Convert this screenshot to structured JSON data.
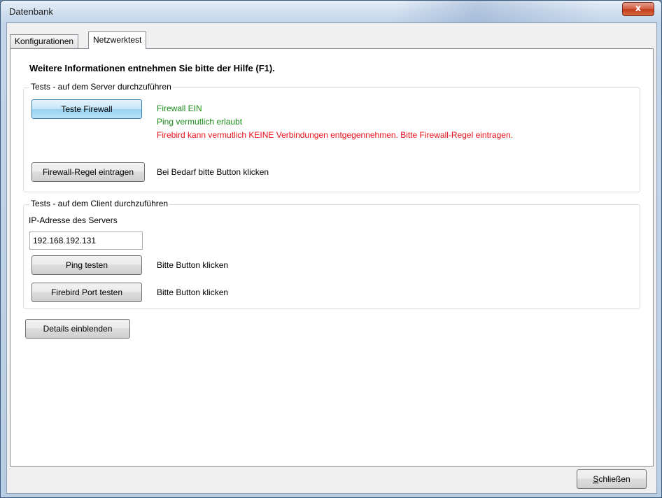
{
  "window": {
    "title": "Datenbank",
    "close_label": "x"
  },
  "tabs": [
    {
      "label": "Konfigurationen",
      "active": false
    },
    {
      "label": "Netzwerktest",
      "active": true
    }
  ],
  "heading": "Weitere Informationen entnehmen Sie bitte der Hilfe (F1).",
  "server_group": {
    "title": "Tests - auf dem Server durchzuführen",
    "test_firewall_button": "Teste Firewall",
    "status_lines": [
      {
        "text": "Firewall EIN",
        "color": "#1a8a1a"
      },
      {
        "text": "Ping vermutlich erlaubt",
        "color": "#1a8a1a"
      },
      {
        "text": "Firebird kann vermutlich KEINE Verbindungen entgegennehmen. Bitte Firewall-Regel eintragen.",
        "color": "#e8101a"
      }
    ],
    "add_rule_button": "Firewall-Regel eintragen",
    "add_rule_hint": "Bei Bedarf bitte Button klicken"
  },
  "client_group": {
    "title": "Tests - auf dem Client durchzuführen",
    "ip_label": "IP-Adresse des Servers",
    "ip_value": "192.168.192.131",
    "ping_button": "Ping testen",
    "ping_hint": "Bitte Button klicken",
    "port_button": "Firebird Port testen",
    "port_hint": "Bitte Button klicken"
  },
  "details_button": "Details einblenden",
  "close_button": {
    "underlined_char": "S",
    "rest": "chließen"
  }
}
